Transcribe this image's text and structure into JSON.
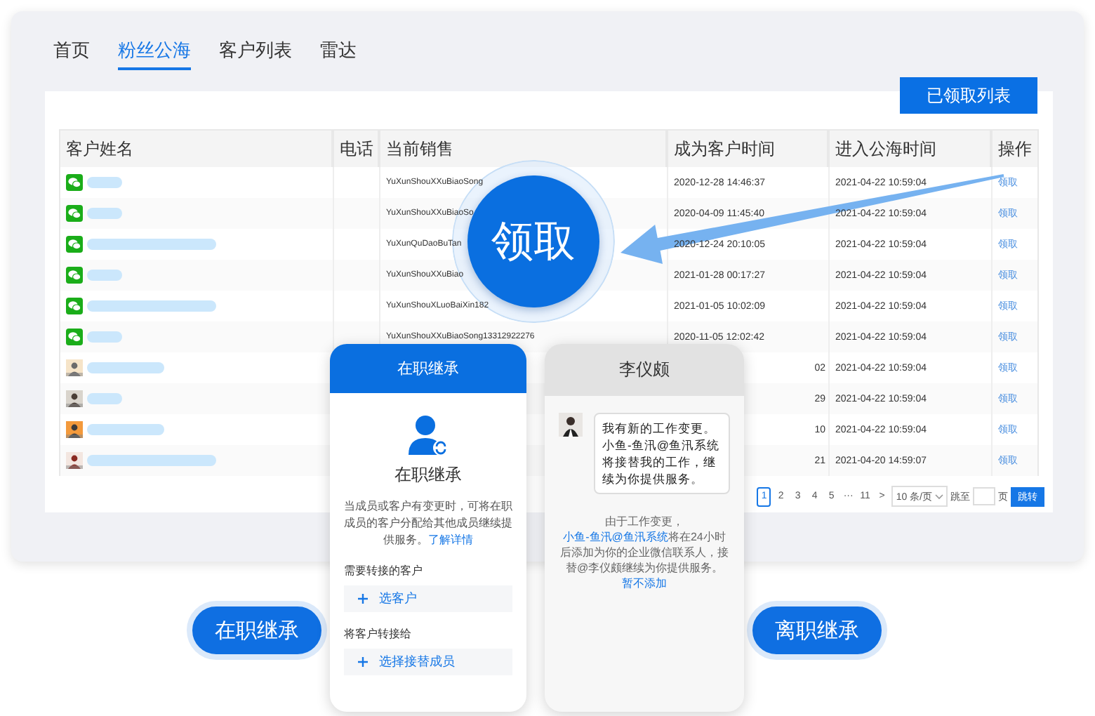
{
  "tabs": [
    {
      "label": "首页",
      "selected": false
    },
    {
      "label": "粉丝公海",
      "selected": true
    },
    {
      "label": "客户列表",
      "selected": false
    },
    {
      "label": "雷达",
      "selected": false
    }
  ],
  "claimed_list_button": "已领取列表",
  "table": {
    "columns": [
      "客户姓名",
      "电话",
      "当前销售",
      "成为客户时间",
      "进入公海时间",
      "操作"
    ],
    "rows": [
      {
        "kind": "wechat",
        "sales": "YuXunShouXXuBiaoSong",
        "became": "2020-12-28 14:46:37",
        "entered": "2021-04-22 10:59:04",
        "action": "领取"
      },
      {
        "kind": "wechat",
        "sales": "YuXunShouXXuBiaoSo",
        "became": "2020-04-09 11:45:40",
        "entered": "2021-04-22 10:59:04",
        "action": "领取"
      },
      {
        "kind": "wechat",
        "sales": "YuXunQuDaoBuTan",
        "became": "2020-12-24 20:10:05",
        "entered": "2021-04-22 10:59:04",
        "action": "领取"
      },
      {
        "kind": "wechat",
        "sales": "YuXunShouXXuBiao",
        "became": "2021-01-28 00:17:27",
        "entered": "2021-04-22 10:59:04",
        "action": "领取"
      },
      {
        "kind": "wechat",
        "sales": "YuXunShouXLuoBaiXin182",
        "became": "2021-01-05 10:02:09",
        "entered": "2021-04-22 10:59:04",
        "action": "领取"
      },
      {
        "kind": "wechat",
        "sales": "YuXunShouXXuBiaoSong13312922276",
        "became": "2020-11-05 12:02:42",
        "entered": "2021-04-22 10:59:04",
        "action": "领取"
      },
      {
        "kind": "avatar",
        "became_tail": "02",
        "entered": "2021-04-22 10:59:04",
        "action": "领取"
      },
      {
        "kind": "avatar",
        "became_tail": "29",
        "entered": "2021-04-22 10:59:04",
        "action": "领取"
      },
      {
        "kind": "avatar",
        "became_tail": "10",
        "entered": "2021-04-22 10:59:04",
        "action": "领取"
      },
      {
        "kind": "avatar",
        "became_tail": "21",
        "entered": "2021-04-20 14:59:07",
        "action": "领取"
      }
    ]
  },
  "pagination": {
    "pages": [
      {
        "label": "1",
        "selected": true
      },
      {
        "label": "2",
        "selected": false
      },
      {
        "label": "3",
        "selected": false
      },
      {
        "label": "4",
        "selected": false
      },
      {
        "label": "5",
        "selected": false
      },
      {
        "label": "···",
        "selected": false
      },
      {
        "label": "11",
        "selected": false
      }
    ],
    "next": ">",
    "page_size": "10 条/页",
    "jump_label": "跳至",
    "page_unit": "页",
    "jump_button": "跳转"
  },
  "claim_button": "领取",
  "active_card": {
    "header": "在职继承",
    "title": "在职继承",
    "description": "当成员或客户有变更时，可将在职成员的客户分配给其他成员继续提供服务。",
    "link": "了解详情",
    "sections": [
      {
        "label": "需要转接的客户",
        "action": "选客户"
      },
      {
        "label": "将客户转接给",
        "action": "选择接替成员"
      }
    ]
  },
  "resigned_card": {
    "header": "李仪颇",
    "message": "我有新的工作变更。小鱼-鱼汛@鱼汛系统将接替我的工作，继续为你提供服务。",
    "notice_start": "由于工作变更，",
    "notice_link": "小鱼-鱼汛@鱼汛系统",
    "notice_middle": "将在24小时后添加为你的企业微信联系人，接替@李仪颇继续为你提供服务。",
    "notice_action": "暂不添加"
  },
  "buttons": [
    "在职继承",
    "离职继承"
  ]
}
